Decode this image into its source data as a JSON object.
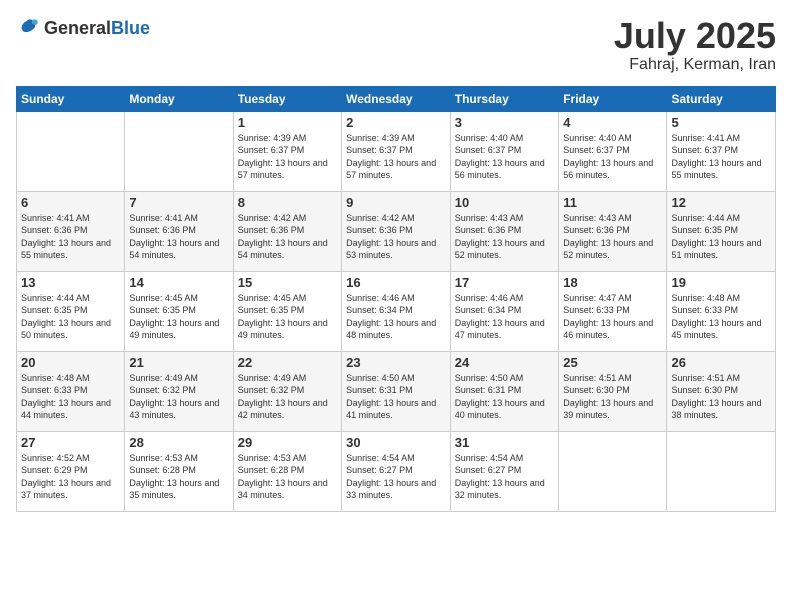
{
  "header": {
    "logo_general": "General",
    "logo_blue": "Blue",
    "month_year": "July 2025",
    "location": "Fahraj, Kerman, Iran"
  },
  "weekdays": [
    "Sunday",
    "Monday",
    "Tuesday",
    "Wednesday",
    "Thursday",
    "Friday",
    "Saturday"
  ],
  "weeks": [
    [
      {
        "day": "",
        "info": ""
      },
      {
        "day": "",
        "info": ""
      },
      {
        "day": "1",
        "info": "Sunrise: 4:39 AM\nSunset: 6:37 PM\nDaylight: 13 hours and 57 minutes."
      },
      {
        "day": "2",
        "info": "Sunrise: 4:39 AM\nSunset: 6:37 PM\nDaylight: 13 hours and 57 minutes."
      },
      {
        "day": "3",
        "info": "Sunrise: 4:40 AM\nSunset: 6:37 PM\nDaylight: 13 hours and 56 minutes."
      },
      {
        "day": "4",
        "info": "Sunrise: 4:40 AM\nSunset: 6:37 PM\nDaylight: 13 hours and 56 minutes."
      },
      {
        "day": "5",
        "info": "Sunrise: 4:41 AM\nSunset: 6:37 PM\nDaylight: 13 hours and 55 minutes."
      }
    ],
    [
      {
        "day": "6",
        "info": "Sunrise: 4:41 AM\nSunset: 6:36 PM\nDaylight: 13 hours and 55 minutes."
      },
      {
        "day": "7",
        "info": "Sunrise: 4:41 AM\nSunset: 6:36 PM\nDaylight: 13 hours and 54 minutes."
      },
      {
        "day": "8",
        "info": "Sunrise: 4:42 AM\nSunset: 6:36 PM\nDaylight: 13 hours and 54 minutes."
      },
      {
        "day": "9",
        "info": "Sunrise: 4:42 AM\nSunset: 6:36 PM\nDaylight: 13 hours and 53 minutes."
      },
      {
        "day": "10",
        "info": "Sunrise: 4:43 AM\nSunset: 6:36 PM\nDaylight: 13 hours and 52 minutes."
      },
      {
        "day": "11",
        "info": "Sunrise: 4:43 AM\nSunset: 6:36 PM\nDaylight: 13 hours and 52 minutes."
      },
      {
        "day": "12",
        "info": "Sunrise: 4:44 AM\nSunset: 6:35 PM\nDaylight: 13 hours and 51 minutes."
      }
    ],
    [
      {
        "day": "13",
        "info": "Sunrise: 4:44 AM\nSunset: 6:35 PM\nDaylight: 13 hours and 50 minutes."
      },
      {
        "day": "14",
        "info": "Sunrise: 4:45 AM\nSunset: 6:35 PM\nDaylight: 13 hours and 49 minutes."
      },
      {
        "day": "15",
        "info": "Sunrise: 4:45 AM\nSunset: 6:35 PM\nDaylight: 13 hours and 49 minutes."
      },
      {
        "day": "16",
        "info": "Sunrise: 4:46 AM\nSunset: 6:34 PM\nDaylight: 13 hours and 48 minutes."
      },
      {
        "day": "17",
        "info": "Sunrise: 4:46 AM\nSunset: 6:34 PM\nDaylight: 13 hours and 47 minutes."
      },
      {
        "day": "18",
        "info": "Sunrise: 4:47 AM\nSunset: 6:33 PM\nDaylight: 13 hours and 46 minutes."
      },
      {
        "day": "19",
        "info": "Sunrise: 4:48 AM\nSunset: 6:33 PM\nDaylight: 13 hours and 45 minutes."
      }
    ],
    [
      {
        "day": "20",
        "info": "Sunrise: 4:48 AM\nSunset: 6:33 PM\nDaylight: 13 hours and 44 minutes."
      },
      {
        "day": "21",
        "info": "Sunrise: 4:49 AM\nSunset: 6:32 PM\nDaylight: 13 hours and 43 minutes."
      },
      {
        "day": "22",
        "info": "Sunrise: 4:49 AM\nSunset: 6:32 PM\nDaylight: 13 hours and 42 minutes."
      },
      {
        "day": "23",
        "info": "Sunrise: 4:50 AM\nSunset: 6:31 PM\nDaylight: 13 hours and 41 minutes."
      },
      {
        "day": "24",
        "info": "Sunrise: 4:50 AM\nSunset: 6:31 PM\nDaylight: 13 hours and 40 minutes."
      },
      {
        "day": "25",
        "info": "Sunrise: 4:51 AM\nSunset: 6:30 PM\nDaylight: 13 hours and 39 minutes."
      },
      {
        "day": "26",
        "info": "Sunrise: 4:51 AM\nSunset: 6:30 PM\nDaylight: 13 hours and 38 minutes."
      }
    ],
    [
      {
        "day": "27",
        "info": "Sunrise: 4:52 AM\nSunset: 6:29 PM\nDaylight: 13 hours and 37 minutes."
      },
      {
        "day": "28",
        "info": "Sunrise: 4:53 AM\nSunset: 6:28 PM\nDaylight: 13 hours and 35 minutes."
      },
      {
        "day": "29",
        "info": "Sunrise: 4:53 AM\nSunset: 6:28 PM\nDaylight: 13 hours and 34 minutes."
      },
      {
        "day": "30",
        "info": "Sunrise: 4:54 AM\nSunset: 6:27 PM\nDaylight: 13 hours and 33 minutes."
      },
      {
        "day": "31",
        "info": "Sunrise: 4:54 AM\nSunset: 6:27 PM\nDaylight: 13 hours and 32 minutes."
      },
      {
        "day": "",
        "info": ""
      },
      {
        "day": "",
        "info": ""
      }
    ]
  ]
}
